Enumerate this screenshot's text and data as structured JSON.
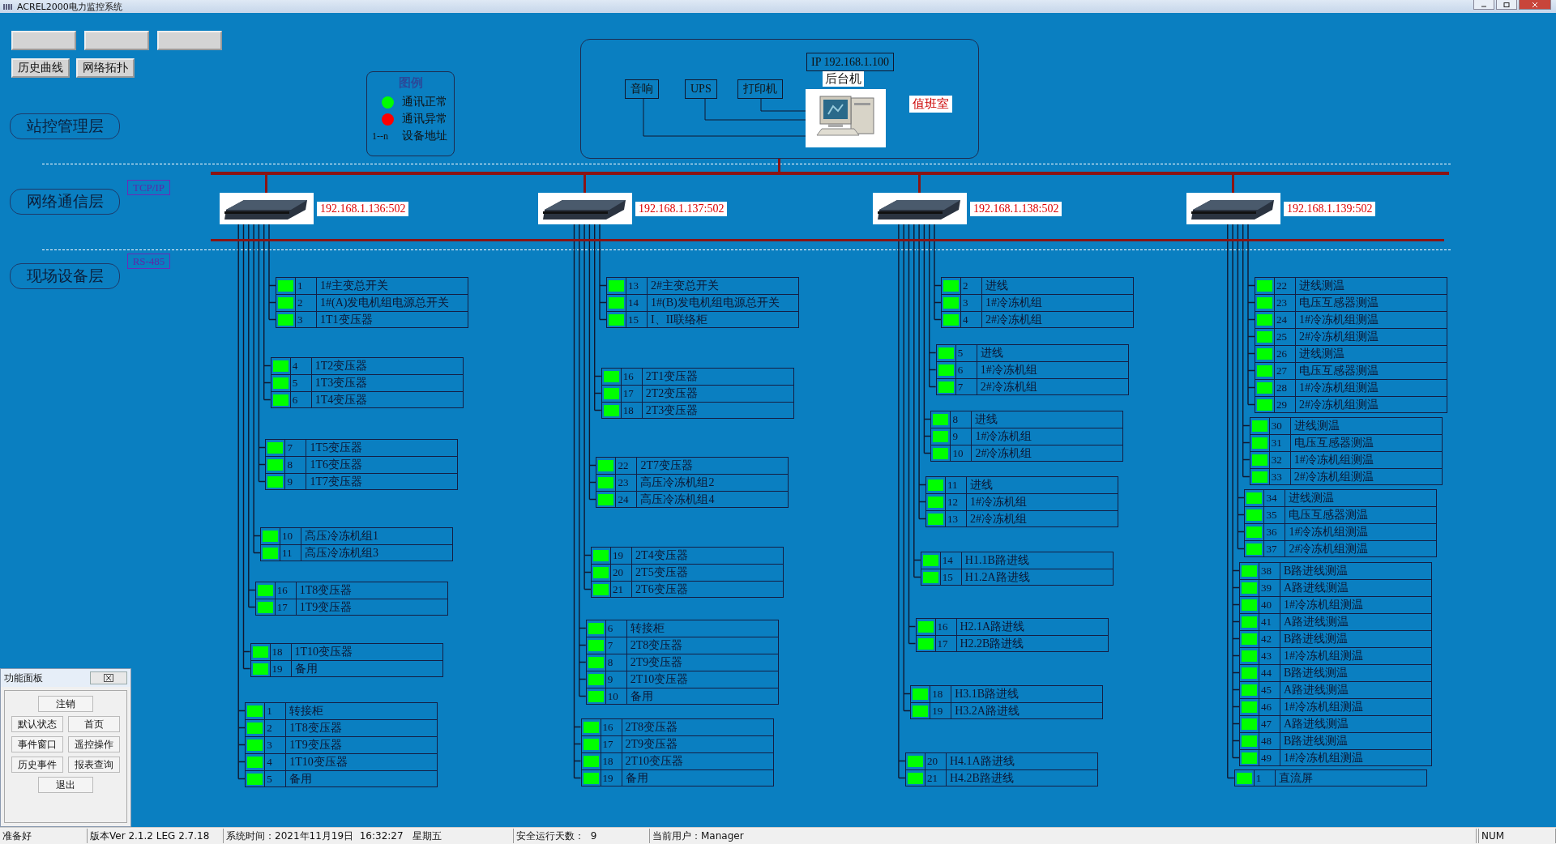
{
  "window": {
    "title": "ACREL2000电力监控系统"
  },
  "obscured_buttons": [
    {
      "kind": "button"
    },
    {
      "kind": "button"
    },
    {
      "kind": "button"
    }
  ],
  "toolbar": [
    {
      "label": "历史曲线"
    },
    {
      "label": "网络拓扑"
    }
  ],
  "layers": [
    {
      "label": "站控管理层"
    },
    {
      "label": "网络通信层",
      "protocol": "TCP/IP"
    },
    {
      "label": "现场设备层",
      "protocol": "RS-485"
    }
  ],
  "legend": {
    "title": "图例",
    "items": [
      {
        "kind": "dot",
        "color": "#00ff00",
        "label": "通讯正常"
      },
      {
        "kind": "dot",
        "color": "#ff0000",
        "label": "通讯异常"
      },
      {
        "kind": "text",
        "symbol": "1--n",
        "label": "设备地址"
      }
    ]
  },
  "station": {
    "ip": "IP 192.168.1.100",
    "host_label": "后台机",
    "devices": [
      "音响",
      "UPS",
      "打印机"
    ],
    "room": "值班室"
  },
  "columns": [
    {
      "address": "192.168.1.136:502",
      "groups": [
        [
          {
            "no": "1",
            "name": "1#主变总开关",
            "ok": true
          },
          {
            "no": "2",
            "name": "1#(A)发电机组电源总开关",
            "ok": true
          },
          {
            "no": "3",
            "name": "1T1变压器",
            "ok": true
          }
        ],
        [
          {
            "no": "4",
            "name": "1T2变压器",
            "ok": true
          },
          {
            "no": "5",
            "name": "1T3变压器",
            "ok": true
          },
          {
            "no": "6",
            "name": "1T4变压器",
            "ok": true
          }
        ],
        [
          {
            "no": "7",
            "name": "1T5变压器",
            "ok": true
          },
          {
            "no": "8",
            "name": "1T6变压器",
            "ok": true
          },
          {
            "no": "9",
            "name": "1T7变压器",
            "ok": true
          }
        ],
        [
          {
            "no": "10",
            "name": "高压冷冻机组1",
            "ok": true
          },
          {
            "no": "11",
            "name": "高压冷冻机组3",
            "ok": true
          }
        ],
        [
          {
            "no": "16",
            "name": "1T8变压器",
            "ok": true
          },
          {
            "no": "17",
            "name": "1T9变压器",
            "ok": true
          }
        ],
        [
          {
            "no": "18",
            "name": "1T10变压器",
            "ok": true
          },
          {
            "no": "19",
            "name": "备用",
            "ok": true
          }
        ],
        [
          {
            "no": "1",
            "name": "转接柜",
            "ok": true
          },
          {
            "no": "2",
            "name": "1T8变压器",
            "ok": true
          },
          {
            "no": "3",
            "name": "1T9变压器",
            "ok": true
          },
          {
            "no": "4",
            "name": "1T10变压器",
            "ok": true
          },
          {
            "no": "5",
            "name": "备用",
            "ok": true
          }
        ]
      ]
    },
    {
      "address": "192.168.1.137:502",
      "groups": [
        [
          {
            "no": "13",
            "name": "2#主变总开关",
            "ok": true
          },
          {
            "no": "14",
            "name": "1#(B)发电机组电源总开关",
            "ok": true
          },
          {
            "no": "15",
            "name": "I、II联络柜",
            "ok": true
          }
        ],
        [
          {
            "no": "16",
            "name": "2T1变压器",
            "ok": true
          },
          {
            "no": "17",
            "name": "2T2变压器",
            "ok": true
          },
          {
            "no": "18",
            "name": "2T3变压器",
            "ok": true
          }
        ],
        [
          {
            "no": "22",
            "name": "2T7变压器",
            "ok": true
          },
          {
            "no": "23",
            "name": "高压冷冻机组2",
            "ok": true
          },
          {
            "no": "24",
            "name": "高压冷冻机组4",
            "ok": true
          }
        ],
        [
          {
            "no": "19",
            "name": "2T4变压器",
            "ok": true
          },
          {
            "no": "20",
            "name": "2T5变压器",
            "ok": true
          },
          {
            "no": "21",
            "name": "2T6变压器",
            "ok": true
          }
        ],
        [
          {
            "no": "6",
            "name": "转接柜",
            "ok": true
          },
          {
            "no": "7",
            "name": "2T8变压器",
            "ok": true
          },
          {
            "no": "8",
            "name": "2T9变压器",
            "ok": true
          },
          {
            "no": "9",
            "name": "2T10变压器",
            "ok": true
          },
          {
            "no": "10",
            "name": "备用",
            "ok": true
          }
        ],
        [
          {
            "no": "16",
            "name": "2T8变压器",
            "ok": true
          },
          {
            "no": "17",
            "name": "2T9变压器",
            "ok": true
          },
          {
            "no": "18",
            "name": "2T10变压器",
            "ok": true
          },
          {
            "no": "19",
            "name": "备用",
            "ok": true
          }
        ]
      ]
    },
    {
      "address": "192.168.1.138:502",
      "groups": [
        [
          {
            "no": "2",
            "name": "进线",
            "ok": true
          },
          {
            "no": "3",
            "name": "1#冷冻机组",
            "ok": true
          },
          {
            "no": "4",
            "name": "2#冷冻机组",
            "ok": true
          }
        ],
        [
          {
            "no": "5",
            "name": "进线",
            "ok": true
          },
          {
            "no": "6",
            "name": "1#冷冻机组",
            "ok": true
          },
          {
            "no": "7",
            "name": "2#冷冻机组",
            "ok": true
          }
        ],
        [
          {
            "no": "8",
            "name": "进线",
            "ok": true
          },
          {
            "no": "9",
            "name": "1#冷冻机组",
            "ok": true
          },
          {
            "no": "10",
            "name": "2#冷冻机组",
            "ok": true
          }
        ],
        [
          {
            "no": "11",
            "name": "进线",
            "ok": true
          },
          {
            "no": "12",
            "name": "1#冷冻机组",
            "ok": true
          },
          {
            "no": "13",
            "name": "2#冷冻机组",
            "ok": true
          }
        ],
        [
          {
            "no": "14",
            "name": "H1.1B路进线",
            "ok": true
          },
          {
            "no": "15",
            "name": "H1.2A路进线",
            "ok": true
          }
        ],
        [
          {
            "no": "16",
            "name": "H2.1A路进线",
            "ok": true
          },
          {
            "no": "17",
            "name": "H2.2B路进线",
            "ok": true
          }
        ],
        [
          {
            "no": "18",
            "name": "H3.1B路进线",
            "ok": true
          },
          {
            "no": "19",
            "name": "H3.2A路进线",
            "ok": true
          }
        ],
        [
          {
            "no": "20",
            "name": "H4.1A路进线",
            "ok": true
          },
          {
            "no": "21",
            "name": "H4.2B路进线",
            "ok": true
          }
        ]
      ]
    },
    {
      "address": "192.168.1.139:502",
      "groups": [
        [
          {
            "no": "22",
            "name": "进线测温",
            "ok": true
          },
          {
            "no": "23",
            "name": "电压互感器测温",
            "ok": true
          },
          {
            "no": "24",
            "name": "1#冷冻机组测温",
            "ok": true
          },
          {
            "no": "25",
            "name": "2#冷冻机组测温",
            "ok": true
          },
          {
            "no": "26",
            "name": "进线测温",
            "ok": true
          },
          {
            "no": "27",
            "name": "电压互感器测温",
            "ok": true
          },
          {
            "no": "28",
            "name": "1#冷冻机组测温",
            "ok": true
          },
          {
            "no": "29",
            "name": "2#冷冻机组测温",
            "ok": true
          }
        ],
        [
          {
            "no": "30",
            "name": "进线测温",
            "ok": true
          },
          {
            "no": "31",
            "name": "电压互感器测温",
            "ok": true
          },
          {
            "no": "32",
            "name": "1#冷冻机组测温",
            "ok": true
          },
          {
            "no": "33",
            "name": "2#冷冻机组测温",
            "ok": true
          }
        ],
        [
          {
            "no": "34",
            "name": "进线测温",
            "ok": true
          },
          {
            "no": "35",
            "name": "电压互感器测温",
            "ok": true
          },
          {
            "no": "36",
            "name": "1#冷冻机组测温",
            "ok": true
          },
          {
            "no": "37",
            "name": "2#冷冻机组测温",
            "ok": true
          }
        ],
        [
          {
            "no": "38",
            "name": "B路进线测温",
            "ok": true
          },
          {
            "no": "39",
            "name": "A路进线测温",
            "ok": true
          },
          {
            "no": "40",
            "name": "1#冷冻机组测温",
            "ok": true
          },
          {
            "no": "41",
            "name": "A路进线测温",
            "ok": true
          },
          {
            "no": "42",
            "name": "B路进线测温",
            "ok": true
          },
          {
            "no": "43",
            "name": "1#冷冻机组测温",
            "ok": true
          },
          {
            "no": "44",
            "name": "B路进线测温",
            "ok": true
          },
          {
            "no": "45",
            "name": "A路进线测温",
            "ok": true
          },
          {
            "no": "46",
            "name": "1#冷冻机组测温",
            "ok": true
          },
          {
            "no": "47",
            "name": "A路进线测温",
            "ok": true
          },
          {
            "no": "48",
            "name": "B路进线测温",
            "ok": true
          },
          {
            "no": "49",
            "name": "1#冷冻机组测温",
            "ok": true
          }
        ],
        [
          {
            "no": "1",
            "name": "直流屏",
            "ok": true
          }
        ]
      ]
    }
  ],
  "function_panel": {
    "title": "功能面板",
    "rows": [
      [
        "注销"
      ],
      [
        "默认状态",
        "首页"
      ],
      [
        "事件窗口",
        "遥控操作"
      ],
      [
        "历史事件",
        "报表查询"
      ],
      [
        "退出"
      ]
    ]
  },
  "status_bar": [
    "准备好",
    "版本Ver 2.1.2 LEG 2.7.18",
    "系统时间：2021年11月19日  16:32:27   星期五",
    "安全运行天数：  9",
    "当前用户：Manager",
    "NUM"
  ]
}
